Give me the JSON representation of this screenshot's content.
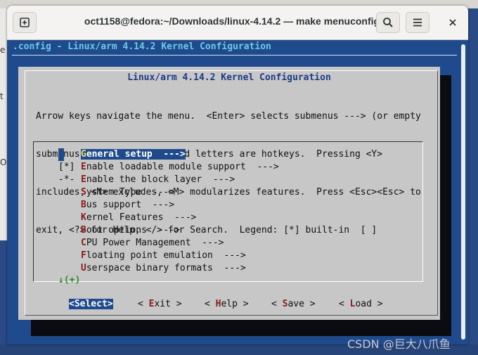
{
  "window": {
    "title": "oct1158@fedora:~/Downloads/linux-4.14.2 — make menuconfig",
    "new_tab_icon": "new-tab-icon",
    "search_icon": "search-icon",
    "menu_icon": "hamburger-menu-icon",
    "close_icon": "close-icon"
  },
  "desktop": {
    "left_fragments": [
      "e",
      "t",
      "ON"
    ]
  },
  "terminal": {
    "config_title": ".config - Linux/arm 4.14.2 Kernel Configuration",
    "dialog_title": "Linux/arm 4.14.2 Kernel Configuration",
    "help_lines": [
      "Arrow keys navigate the menu.  <Enter> selects submenus ---> (or empty",
      "submenus ----).  Highlighted letters are hotkeys.  Pressing <Y>",
      "includes, <N> excludes, <M> modularizes features.  Press <Esc><Esc> to",
      "exit, <?> for Help, </> for Search.  Legend: [*] built-in  [ ]"
    ],
    "menu_items": [
      {
        "marker": "",
        "hotkey": "G",
        "rest": "eneral setup  --->",
        "selected": true
      },
      {
        "marker": "[*]",
        "hotkey": "E",
        "rest": "nable loadable module support  --->",
        "selected": false
      },
      {
        "marker": "-*-",
        "hotkey": "E",
        "rest": "nable the block layer  --->",
        "selected": false
      },
      {
        "marker": "",
        "hotkey": "S",
        "rest": "ystem Type  --->",
        "selected": false
      },
      {
        "marker": "",
        "hotkey": "B",
        "rest": "us support  --->",
        "selected": false
      },
      {
        "marker": "",
        "hotkey": "K",
        "rest": "ernel Features  --->",
        "selected": false
      },
      {
        "marker": "",
        "hotkey": "B",
        "rest": "oot options  --->",
        "selected": false
      },
      {
        "marker": "",
        "hotkey": "C",
        "rest": "PU Power Management  --->",
        "selected": false
      },
      {
        "marker": "",
        "hotkey": "F",
        "rest": "loating point emulation  --->",
        "selected": false
      },
      {
        "marker": "",
        "hotkey": "U",
        "rest": "serspace binary formats  --->",
        "selected": false
      }
    ],
    "more_indicator": "↓(+)",
    "buttons": [
      {
        "pre": "<",
        "hotkey": "S",
        "rest": "elect",
        "post": ">",
        "selected": true
      },
      {
        "pre": "< ",
        "hotkey": "E",
        "rest": "xit",
        "post": " >",
        "selected": false
      },
      {
        "pre": "< ",
        "hotkey": "H",
        "rest": "elp",
        "post": " >",
        "selected": false
      },
      {
        "pre": "< ",
        "hotkey": "S",
        "rest": "ave",
        "post": " >",
        "selected": false
      },
      {
        "pre": "< ",
        "hotkey": "L",
        "rest": "oad",
        "post": " >",
        "selected": false
      }
    ]
  },
  "watermark": "CSDN @巨大八爪鱼",
  "colors": {
    "terminal_bg": "#1f4a8c",
    "dialog_bg": "#c7c7c7",
    "hotkey": "#8a1a1a",
    "title_blue": "#1d3b86"
  }
}
